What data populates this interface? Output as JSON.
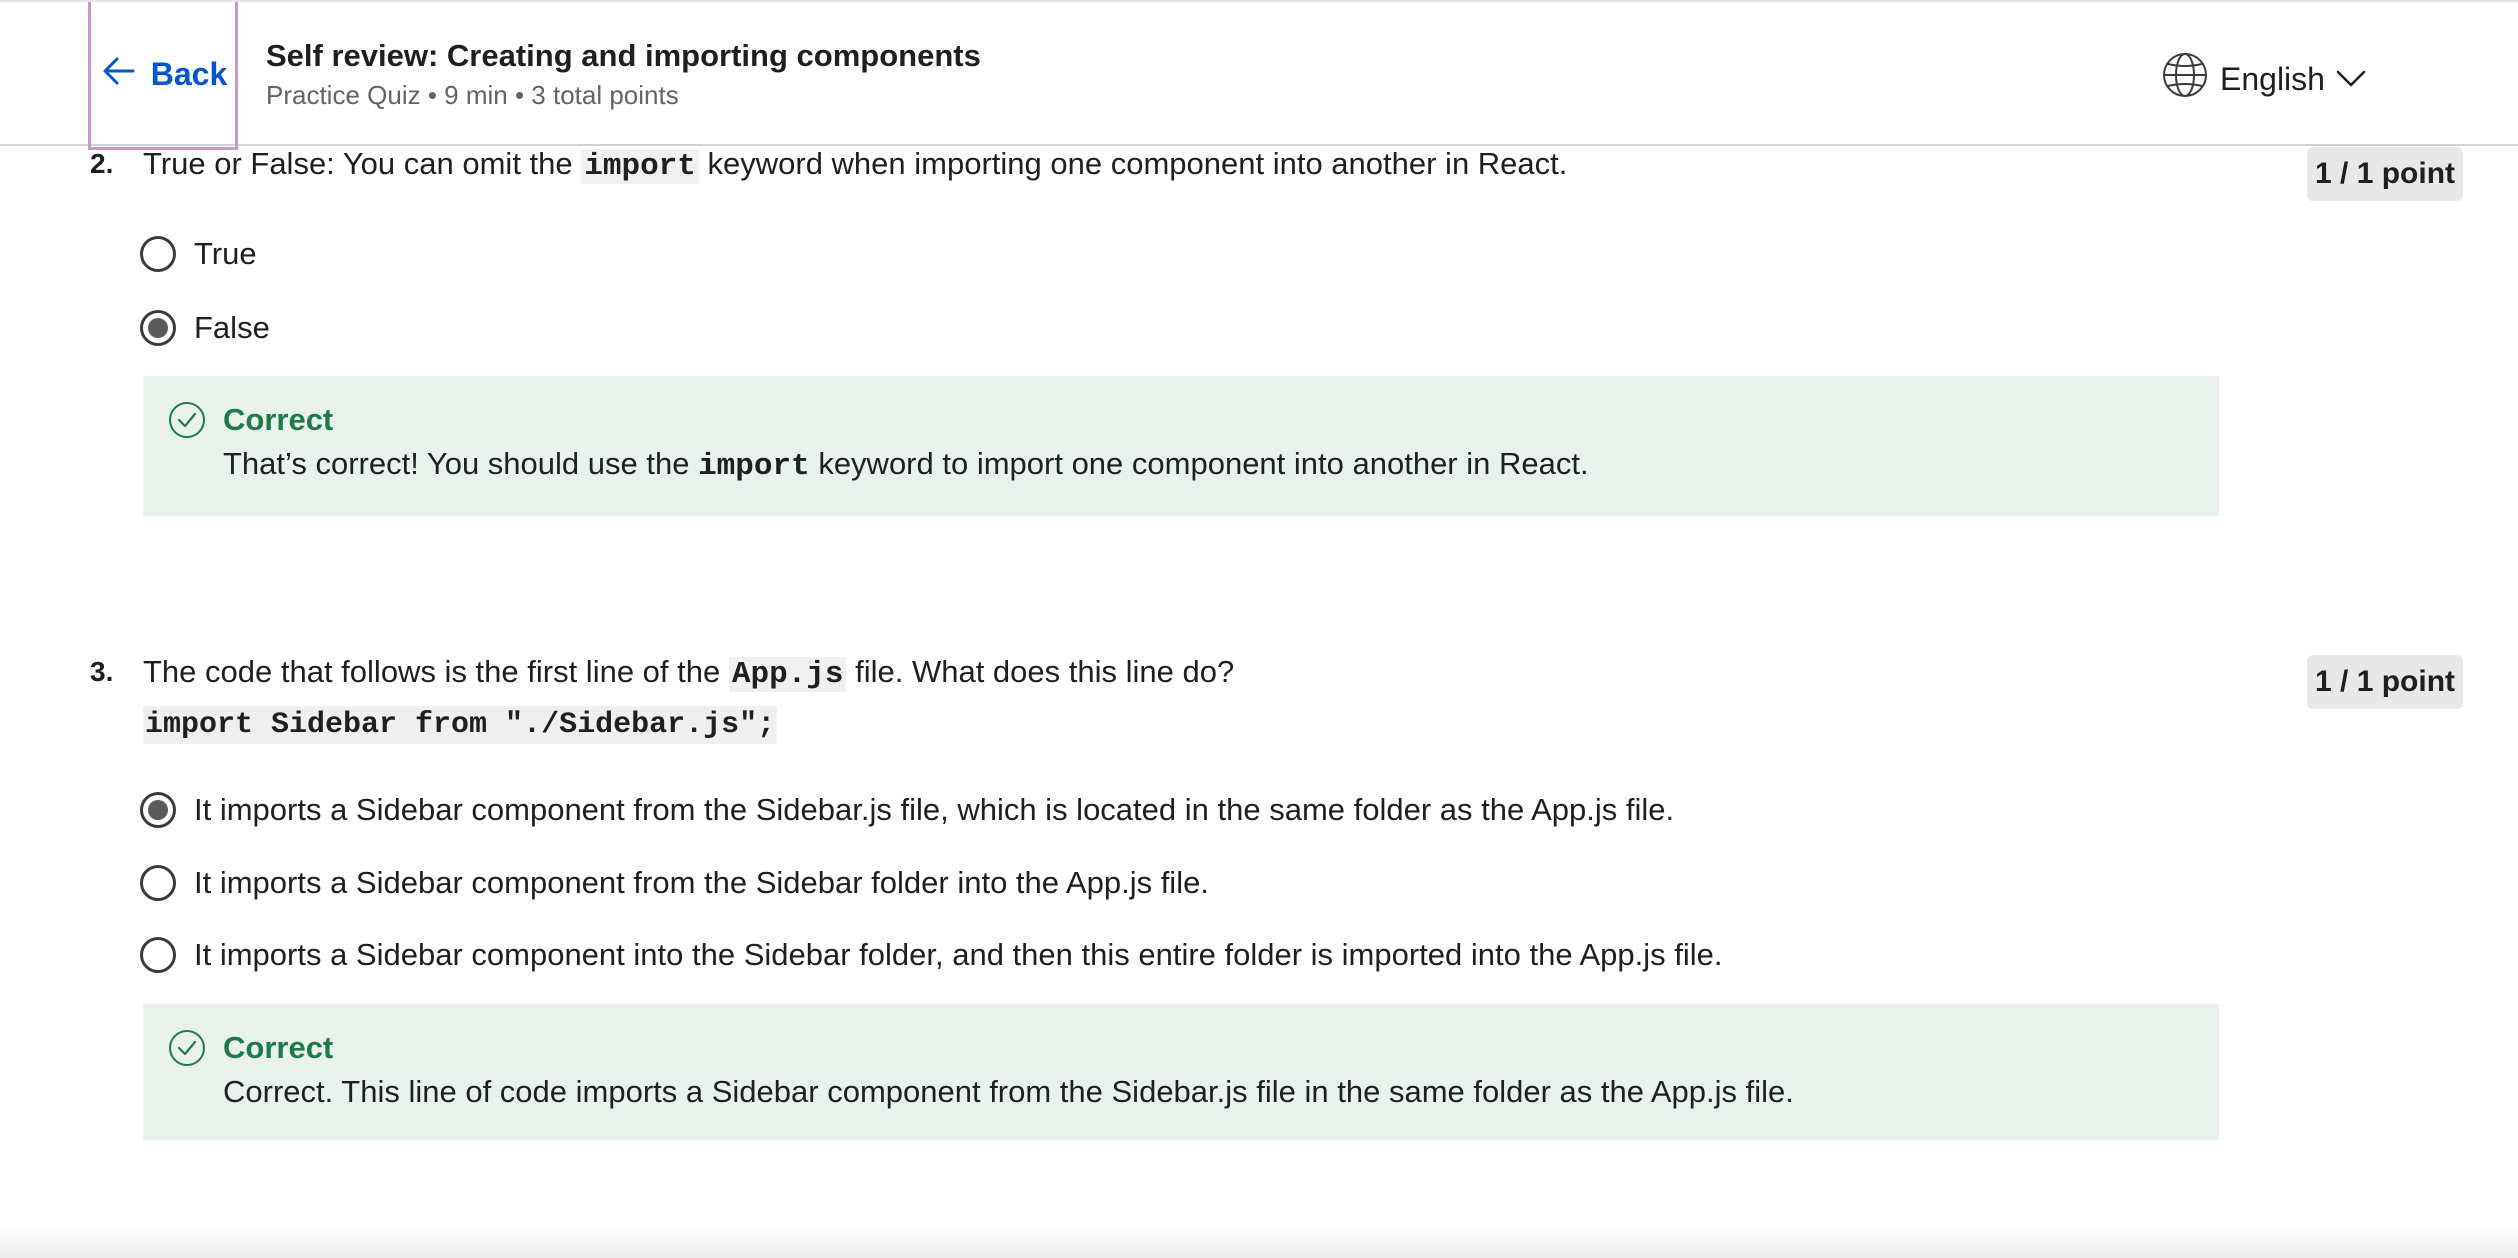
{
  "header": {
    "back_label": "Back",
    "title": "Self review: Creating and importing components",
    "meta": "Practice Quiz • 9 min • 3 total points",
    "language": "English"
  },
  "questions": [
    {
      "number": "2.",
      "text_before": "True or False: You can omit the ",
      "code": "import",
      "text_after": " keyword when importing one component into another in React.",
      "score": "1 / 1 point",
      "options": [
        {
          "label": "True",
          "selected": false
        },
        {
          "label": "False",
          "selected": true
        }
      ],
      "feedback": {
        "title": "Correct",
        "text_before": "That’s correct! You should use the ",
        "code": "import",
        "text_after": " keyword to import one component into another in React."
      }
    },
    {
      "number": "3.",
      "text_before": "The code that follows is the first line of the ",
      "code": "App.js",
      "text_after": " file. What does this line do?",
      "code_line": "import Sidebar from \"./Sidebar.js\";",
      "score": "1 / 1 point",
      "options": [
        {
          "label": "It imports a Sidebar component from the Sidebar.js file, which is located in the same folder as the App.js file.",
          "selected": true
        },
        {
          "label": "It imports a Sidebar component from the Sidebar folder into the App.js file.",
          "selected": false
        },
        {
          "label": "It imports a Sidebar component into the Sidebar folder, and then this entire folder is imported into the App.js file.",
          "selected": false
        }
      ],
      "feedback": {
        "title": "Correct",
        "text": "Correct. This line of code imports a Sidebar component from the Sidebar.js file in the same folder as the App.js file."
      }
    }
  ],
  "colors": {
    "accent": "#0056d2",
    "correct_green": "#1e7a4a",
    "feedback_bg": "#e8f1ec"
  }
}
